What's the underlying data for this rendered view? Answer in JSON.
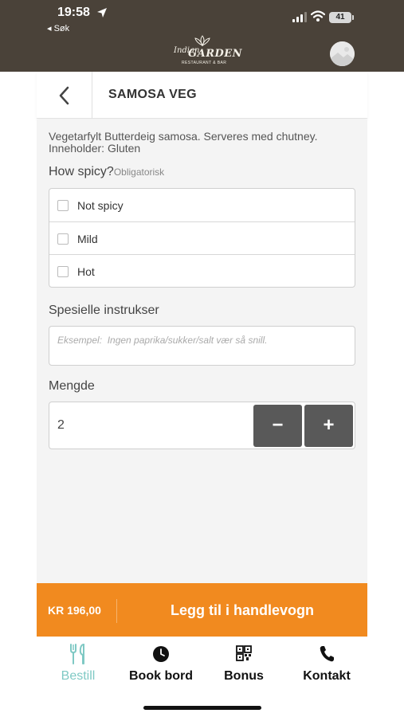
{
  "status_bar": {
    "time": "19:58",
    "back_app": "◂ Søk",
    "battery": "41"
  },
  "brand": {
    "logo_script": "Indian",
    "logo_main": "GARDEN",
    "logo_sub": "RESTAURANT & BAR"
  },
  "header": {
    "title": "SAMOSA VEG"
  },
  "item": {
    "description": "Vegetarfylt Butterdeig samosa. Serveres med chutney. Inneholder: Gluten",
    "spicy_question": "How spicy?",
    "spicy_required": "Obligatorisk",
    "spicy_options": [
      {
        "label": "Not spicy",
        "checked": false
      },
      {
        "label": "Mild",
        "checked": false
      },
      {
        "label": "Hot",
        "checked": false
      }
    ],
    "instructions_label": "Spesielle instrukser",
    "instructions_placeholder": "Eksempel:  Ingen paprika/sukker/salt vær så snill.",
    "instructions_value": "",
    "quantity_label": "Mengde",
    "quantity": "2",
    "minus_label": "−",
    "plus_label": "+"
  },
  "cart": {
    "price": "KR 196,00",
    "add_label": "Legg til i handlevogn"
  },
  "nav": {
    "items": [
      {
        "label": "Bestill",
        "icon": "fork-knife-icon",
        "active": true
      },
      {
        "label": "Book bord",
        "icon": "clock-icon",
        "active": false
      },
      {
        "label": "Bonus",
        "icon": "qr-code-icon",
        "active": false
      },
      {
        "label": "Kontakt",
        "icon": "phone-icon",
        "active": false
      }
    ]
  },
  "colors": {
    "header_bg": "#4a4239",
    "accent_orange": "#f18a1f",
    "active_nav": "#7fc9c4",
    "stepper_button": "#595959"
  }
}
